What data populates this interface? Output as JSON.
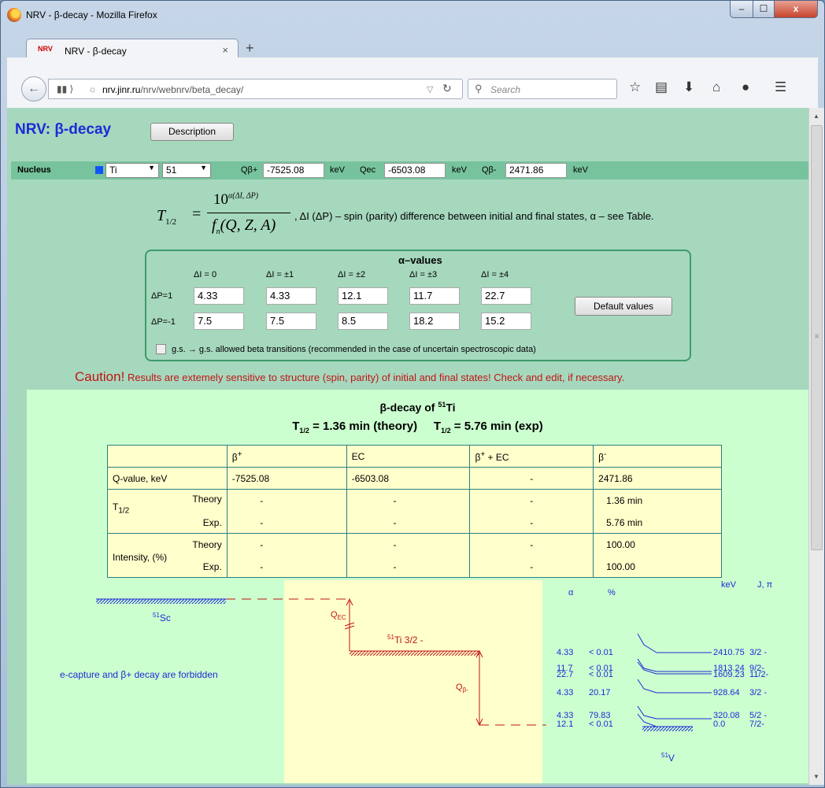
{
  "window": {
    "title": "NRV - β-decay - Mozilla Firefox",
    "min": "–",
    "max": "☐",
    "close": "x"
  },
  "tab": {
    "favicon": "NRV",
    "title": "NRV - β-decay",
    "close": "×",
    "new": "+"
  },
  "nav": {
    "url_host": "nrv.jinr.ru",
    "url_path": "/nrv/webnrv/beta_decay/",
    "search_placeholder": "Search"
  },
  "page": {
    "title": "NRV: β-decay",
    "description_button": "Description",
    "nucleus": {
      "label": "Nucleus",
      "element": "Ti",
      "mass": "51",
      "color": "#1155ff",
      "q_labels": [
        "Qβ+",
        "Qec",
        "Qβ-"
      ],
      "q_values": [
        "-7525.08",
        "-6503.08",
        "2471.86"
      ],
      "unit": "keV"
    },
    "formula_desc": ", ΔI (ΔP) – spin (parity) difference between initial and final states, α – see Table.",
    "alpha": {
      "title": "α–values",
      "headers": [
        "ΔI = 0",
        "ΔI = ±1",
        "ΔI = ±2",
        "ΔI = ±3",
        "ΔI = ±4"
      ],
      "rows": [
        {
          "label": "ΔP=1",
          "values": [
            "4.33",
            "4.33",
            "12.1",
            "11.7",
            "22.7"
          ]
        },
        {
          "label": "ΔP=-1",
          "values": [
            "7.5",
            "7.5",
            "8.5",
            "18.2",
            "15.2"
          ]
        }
      ],
      "default_button": "Default values",
      "checkbox_label": "g.s. → g.s. allowed beta transitions (recommended in the case of uncertain spectroscopic data)"
    },
    "caution_strong": "Caution!",
    "caution_text": " Results are extemely sensitive to structure (spin, parity) of initial and final states! Check and edit, if necessary.",
    "result": {
      "title_pre": "β-decay of ",
      "mass": "51",
      "element": "Ti",
      "t_theory": "= 1.36 min (theory)",
      "t_exp": "= 5.76 min (exp)",
      "headers": [
        "",
        "β+",
        "EC",
        "β+ + EC",
        "β-"
      ],
      "qrow": {
        "label": "Q-value, keV",
        "values": [
          "-7525.08",
          "-6503.08",
          "-",
          "2471.86"
        ]
      },
      "half_life": {
        "label": "T1/2",
        "sub": [
          "Theory",
          "Exp."
        ],
        "theory": [
          "-",
          "-",
          "-",
          "1.36 min"
        ],
        "exp": [
          "-",
          "-",
          "-",
          "5.76 min"
        ]
      },
      "intensity": {
        "label": "Intensity, (%)",
        "sub": [
          "Theory",
          "Exp."
        ],
        "theory": [
          "-",
          "-",
          "-",
          "100.00"
        ],
        "exp": [
          "-",
          "-",
          "-",
          "100.00"
        ]
      }
    },
    "diagram": {
      "parent_left": "Sc",
      "parent_left_mass": "51",
      "forbidden_text": "e-capture and β+ decay are forbidden",
      "q_ec": "Q",
      "q_ec_sub": "EC",
      "mid_mass": "51",
      "mid_label": "Ti 3/2 -",
      "q_beta": "Q",
      "q_beta_sub": "β-",
      "headers": [
        "α",
        "%",
        "keV",
        "J, π"
      ],
      "levels": [
        {
          "alpha": "4.33",
          "pct": "< 0.01",
          "kev": "2410.75",
          "jp": "3/2 -"
        },
        {
          "alpha": "11.7",
          "pct": "< 0.01",
          "kev": "1813.24",
          "jp": "9/2-"
        },
        {
          "alpha": "22.7",
          "pct": "< 0.01",
          "kev": "1609.23",
          "jp": "11/2-"
        },
        {
          "alpha": "4.33",
          "pct": "20.17",
          "kev": "928.64",
          "jp": "3/2 -"
        },
        {
          "alpha": "4.33",
          "pct": "79.83",
          "kev": "320.08",
          "jp": "5/2 -"
        },
        {
          "alpha": "12.1",
          "pct": "< 0.01",
          "kev": "0.0",
          "jp": "7/2-"
        }
      ],
      "daughter": "V",
      "daughter_mass": "51"
    }
  }
}
